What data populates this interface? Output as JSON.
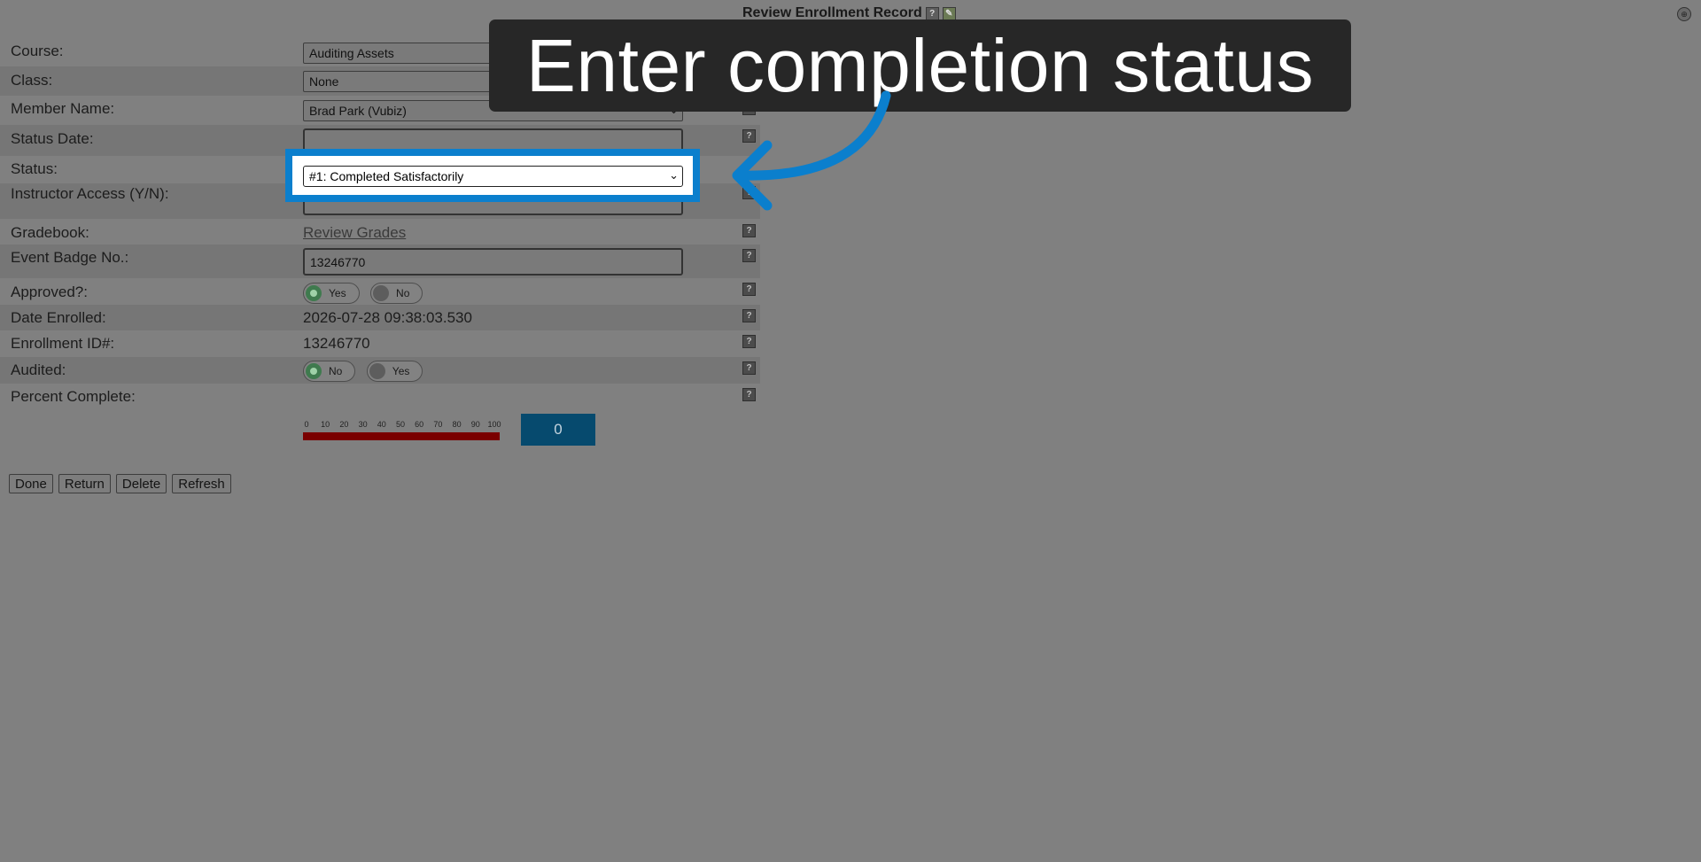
{
  "page": {
    "title": "Review Enrollment Record",
    "help_glyph": "?",
    "corner_glyph": "⊕"
  },
  "form": {
    "course": {
      "label": "Course:",
      "value": "Auditing Assets"
    },
    "class": {
      "label": "Class:",
      "value": "None"
    },
    "member_name": {
      "label": "Member Name:",
      "value": "Brad Park (Vubiz)"
    },
    "status_date": {
      "label": "Status Date:",
      "value": ""
    },
    "status": {
      "label": "Status:",
      "value": "#1: Completed Satisfactorily"
    },
    "instructor_access": {
      "label": "Instructor Access (Y/N):",
      "value": ""
    },
    "gradebook": {
      "label": "Gradebook:",
      "link": "Review Grades"
    },
    "event_badge": {
      "label": "Event Badge No.:",
      "value": "13246770"
    },
    "approved": {
      "label": "Approved?:",
      "options": [
        "Yes",
        "No"
      ],
      "selected": "Yes"
    },
    "date_enrolled": {
      "label": "Date Enrolled:",
      "value": "2026-07-28 09:38:03.530"
    },
    "enrollment_id": {
      "label": "Enrollment ID#:",
      "value": "13246770"
    },
    "audited": {
      "label": "Audited:",
      "options": [
        "No",
        "Yes"
      ],
      "selected": "No"
    },
    "percent_complete": {
      "label": "Percent Complete:",
      "scale": [
        "0",
        "10",
        "20",
        "30",
        "40",
        "50",
        "60",
        "70",
        "80",
        "90",
        "100"
      ],
      "value": "0"
    }
  },
  "buttons": {
    "done": "Done",
    "return": "Return",
    "delete": "Delete",
    "refresh": "Refresh"
  },
  "tutorial": {
    "callout": "Enter completion status",
    "highlight_color": "#0b7fcd"
  }
}
